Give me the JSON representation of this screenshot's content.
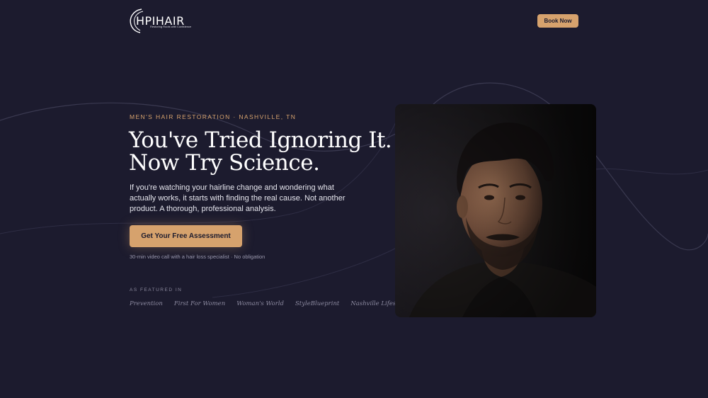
{
  "brand": {
    "name": "HPIHAIR",
    "tagline": "Restoring Roots with Confidence"
  },
  "header": {
    "book_label": "Book Now"
  },
  "hero": {
    "eyebrow": "MEN'S HAIR RESTORATION · NASHVILLE, TN",
    "headline_line1": "You've Tried Ignoring It.",
    "headline_line2": "Now Try Science.",
    "subcopy": "If you're watching your hairline change and wondering what actually works, it starts with finding the real cause. Not another product. A thorough, professional analysis.",
    "cta_label": "Get Your Free Assessment",
    "cta_note": "30-min video call with a hair loss specialist · No obligation"
  },
  "featured": {
    "label": "AS FEATURED IN",
    "outlets": [
      "Prevention",
      "First For Women",
      "Woman's World",
      "StyleBlueprint",
      "Nashville Lifestyles"
    ]
  },
  "colors": {
    "background": "#1c1b2e",
    "accent": "#d6a26d",
    "text": "#ffffff",
    "muted": "#9a98ad"
  }
}
